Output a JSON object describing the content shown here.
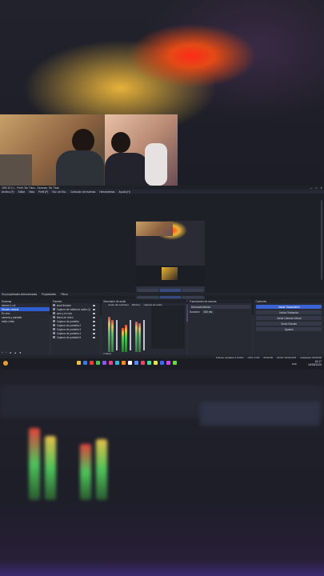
{
  "window": {
    "title": "OBS 32.0.1 - Perfil: Sin Título - Escenas: Sin Título",
    "controls": [
      "—",
      "□",
      "✕"
    ]
  },
  "menu": [
    "Archivo (F)",
    "Editar",
    "Vista",
    "Perfil (P)",
    "Esc. de Esc.",
    "Colección de escenas",
    "Herramientas",
    "Ayuda (H)"
  ],
  "preview_toolbar": [
    "Sin propiedades seleccionadas",
    "Propiedades",
    "Filtros"
  ],
  "docks": {
    "scenes": {
      "title": "Escenas",
      "items": [
        "stream 1 cnl",
        "Stream vertical",
        "En vivo",
        "camera y pantalla",
        "estilo vídeo"
      ],
      "selected_index": 1
    },
    "sources": {
      "title": "Fuentes",
      "items": [
        "chart theatre",
        "Captura de salida de audio (I)",
        "cam y en vivo",
        "Barra de vídeo",
        "Captura de pantalla",
        "Captura de pantalla 2",
        "Captura de pantalla 3",
        "Captura de pantalla 4",
        "Captura de pantalla 5"
      ]
    },
    "mixer": {
      "title": "Mezclador de audio",
      "channels": [
        "Audio del escritorio",
        "Mic/Aux",
        "Captura de audio"
      ],
      "footer": "0 Mixer"
    },
    "transitions": {
      "title": "Transiciones de escena",
      "type": "Desvanecimiento",
      "duration_label": "Duración",
      "duration": "300 ms"
    },
    "controls": {
      "title": "Controles",
      "buttons": [
        "Iniciar Transmisión",
        "Iniciar Grabación",
        "Iniciar Cámara Virtual",
        "Modo Estudio",
        "Ajustes",
        "Salir"
      ]
    }
  },
  "statusbar": [
    "Frames perdidos 0 (0.0%)",
    "CPU: 2.4%",
    "00:00:00",
    "60.00 / 60.00 FPS",
    "Grabando: 00:00:00"
  ],
  "taskbar": {
    "time": "18:17",
    "date": "16/08/2025",
    "lang": "ESP",
    "icon_colors": [
      "#e8c246",
      "#3a7be0",
      "#e0423a",
      "#4ec25a",
      "#8a5be0",
      "#d84a8a",
      "#3ab4d8",
      "#f08a2a",
      "#ffffff",
      "#5a8af0",
      "#e04a6a",
      "#4ad8a0",
      "#e8e04a",
      "#3a6af0",
      "#c84ae0",
      "#6ad84a"
    ]
  },
  "colors": {
    "accent": "#3b63d6",
    "selection": "#2e5fcf",
    "dock_bg": "#272a33",
    "background": "#1a1a22"
  }
}
